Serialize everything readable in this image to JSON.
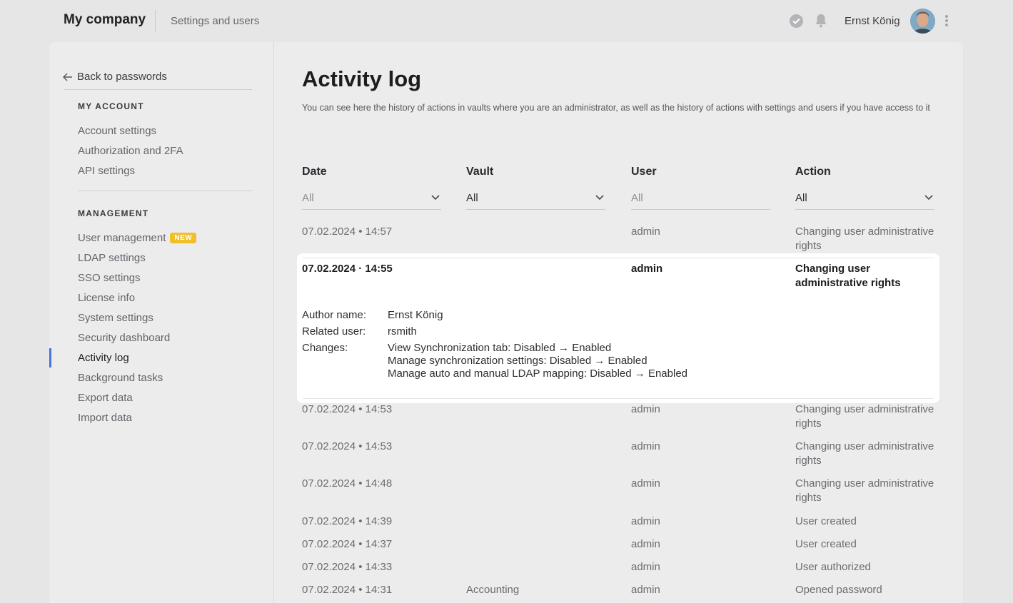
{
  "header": {
    "brand": "My company",
    "section": "Settings and users",
    "user_name": "Ernst König"
  },
  "sidebar": {
    "back_label": "Back to passwords",
    "my_account_heading": "MY ACCOUNT",
    "my_account_items": [
      "Account settings",
      "Authorization and 2FA",
      "API settings"
    ],
    "management_heading": "MANAGEMENT",
    "management_items": [
      {
        "label": "User management",
        "badge": "NEW"
      },
      {
        "label": "LDAP settings"
      },
      {
        "label": "SSO settings"
      },
      {
        "label": "License info"
      },
      {
        "label": "System settings"
      },
      {
        "label": "Security dashboard"
      },
      {
        "label": "Activity log"
      },
      {
        "label": "Background tasks"
      },
      {
        "label": "Export data"
      },
      {
        "label": "Import data"
      }
    ],
    "active_item": "Activity log"
  },
  "main": {
    "title": "Activity log",
    "description": "You can see here the history of actions in vaults where you are an administrator, as well as the history of actions with settings and users if you have access to it",
    "columns": {
      "date": "Date",
      "vault": "Vault",
      "user": "User",
      "action": "Action"
    },
    "filters": {
      "date": "All",
      "vault": "All",
      "user_placeholder": "All",
      "action": "All"
    },
    "rows": [
      {
        "date": "07.02.2024 • 14:57",
        "vault": "",
        "user": "admin",
        "action": "Changing user administrative rights"
      },
      {
        "date": "07.02.2024 • 14:55",
        "vault": "",
        "user": "admin",
        "action": "Changing user administrative rights",
        "expanded": true
      },
      {
        "date": "07.02.2024 • 14:53",
        "vault": "",
        "user": "admin",
        "action": "Changing user administrative rights"
      },
      {
        "date": "07.02.2024 • 14:53",
        "vault": "",
        "user": "admin",
        "action": "Changing user administrative rights"
      },
      {
        "date": "07.02.2024 • 14:48",
        "vault": "",
        "user": "admin",
        "action": "Changing user administrative rights"
      },
      {
        "date": "07.02.2024 • 14:39",
        "vault": "",
        "user": "admin",
        "action": "User created"
      },
      {
        "date": "07.02.2024 • 14:37",
        "vault": "",
        "user": "admin",
        "action": "User created"
      },
      {
        "date": "07.02.2024 • 14:33",
        "vault": "",
        "user": "admin",
        "action": "User authorized"
      },
      {
        "date": "07.02.2024 • 14:31",
        "vault": "Accounting",
        "user": "admin",
        "action": "Opened password"
      }
    ],
    "expanded_detail": {
      "date": "07.02.2024 · 14:55",
      "author_label": "Author name:",
      "author_value": "Ernst König",
      "related_label": "Related user:",
      "related_value": "rsmith",
      "changes_label": "Changes:",
      "changes": [
        "View Synchronization tab: Disabled → Enabled",
        "Manage synchronization settings: Disabled → Enabled",
        "Manage auto and manual LDAP mapping: Disabled → Enabled"
      ]
    }
  },
  "colors": {
    "accent": "#4a74d9",
    "badge": "#f0c02a",
    "background": "#e6e6e7",
    "panel": "#ececed"
  }
}
